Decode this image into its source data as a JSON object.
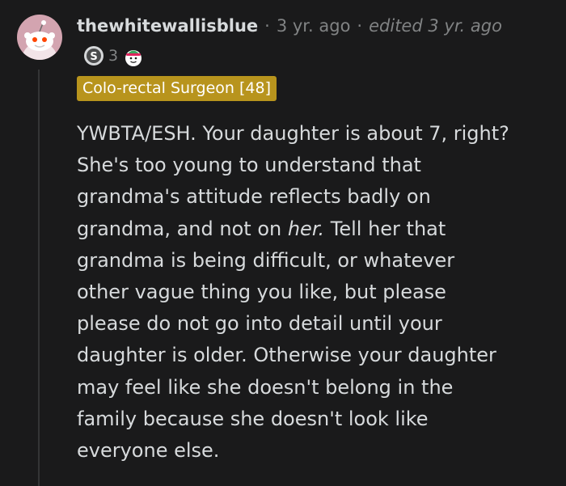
{
  "comment": {
    "username": "thewhitewallisblue",
    "separator": "·",
    "age": "3 yr. ago",
    "edited": "edited 3 yr. ago",
    "awards": [
      {
        "icon": "silver-award-icon",
        "count": "3"
      },
      {
        "icon": "wholesome-award-icon",
        "count": ""
      }
    ],
    "flair": "Colo-rectal Surgeon [48]",
    "body": {
      "line1": "YWBTA/ESH. Your daughter is about 7, right?",
      "line2": "She's too young to understand that",
      "line3": "grandma's attitude reflects badly on",
      "line4_before": "grandma, and not on ",
      "line4_em": "her.",
      "line4_after": " Tell her that",
      "line5": "grandma is being difficult, or whatever",
      "line6": "other vague thing you like, but please",
      "line7": "please do not go into detail until your",
      "line8": "daughter is older. Otherwise your daughter",
      "line9": "may feel like she doesn't belong in the",
      "line10": "family because she doesn't look like",
      "line11": "everyone else."
    }
  },
  "colors": {
    "background": "#1a1a1b",
    "text": "#d7dadc",
    "muted": "#818384",
    "flair_bg": "#b8941d",
    "avatar_bg": "#d3a4b0"
  }
}
